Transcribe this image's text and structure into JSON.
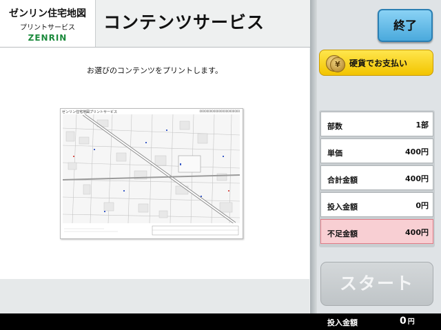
{
  "header": {
    "logo": {
      "line1": "ゼンリン住宅地図",
      "line2": "プリントサービス",
      "line3": "ZENRIN"
    },
    "title": "コンテンツサービス"
  },
  "content": {
    "message": "お選びのコンテンツをプリントします。",
    "preview": {
      "header": "ゼンリン住宅地図プリントサービス",
      "code": "00000000000000000000000"
    }
  },
  "sidebar": {
    "exit_label": "終了",
    "coin_icon_symbol": "¥",
    "payment_label": "硬貨でお支払い",
    "rows": [
      {
        "label": "部数",
        "value": "1部"
      },
      {
        "label": "単価",
        "value": "400円"
      },
      {
        "label": "合計金額",
        "value": "400円"
      },
      {
        "label": "投入金額",
        "value": "0円"
      },
      {
        "label": "不足金額",
        "value": "400円"
      }
    ],
    "start_label": "スタート"
  },
  "status": {
    "label": "投入金額",
    "value": "0",
    "unit": "円"
  },
  "colors": {
    "accent_blue": "#4aa9dc",
    "payment_yellow": "#f2c400",
    "alert_pink": "#f8cfd3",
    "status_bar": "#000000"
  }
}
